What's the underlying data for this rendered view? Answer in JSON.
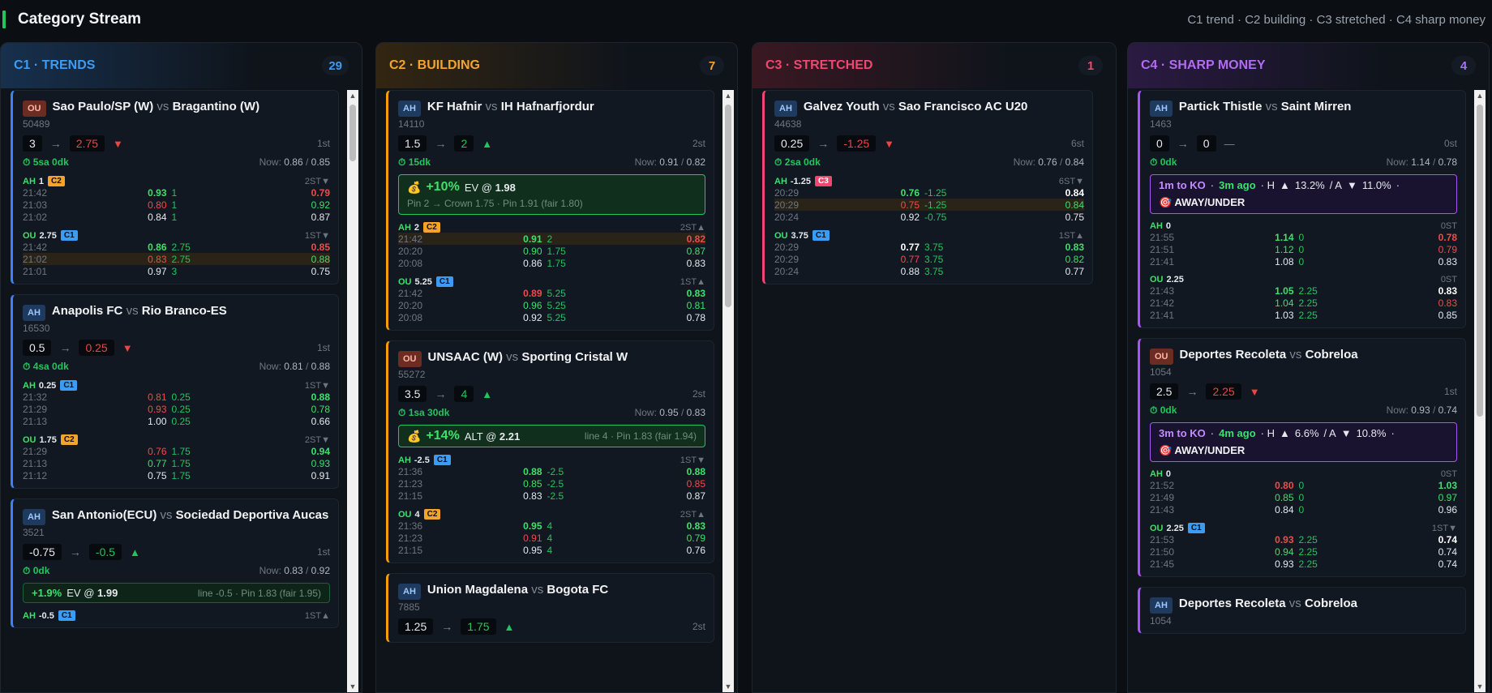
{
  "header": {
    "title": "Category Stream",
    "legend": "C1 trend · C2 building · C3 stretched · C4 sharp money"
  },
  "columns": [
    {
      "title": "C1 · TRENDS",
      "count": "29",
      "cards": [
        {
          "type": "OU",
          "home": "Sao Paulo/SP (W)",
          "away": "Bragantino (W)",
          "id": "50489",
          "from": "3",
          "to": "2.75",
          "toColor": "red",
          "dir": "dn",
          "stage": "1st",
          "time": "5sa 0dk",
          "now_a": "0.86",
          "now_b": "0.85",
          "markets": [
            {
              "kind": "AH",
              "line": "1",
              "cat": "C2",
              "stage": "2ST",
              "dir": "▼",
              "rows": [
                [
                  "21:42",
                  "0.93",
                  "1",
                  "0.79",
                  "gb",
                  "rb",
                  ""
                ],
                [
                  "21:03",
                  "0.80",
                  "1",
                  "0.92",
                  "r",
                  "g",
                  ""
                ],
                [
                  "21:02",
                  "0.84",
                  "1",
                  "0.87",
                  "w",
                  "w",
                  ""
                ]
              ]
            },
            {
              "kind": "OU",
              "line": "2.75",
              "cat": "C1",
              "stage": "1ST",
              "dir": "▼",
              "rows": [
                [
                  "21:42",
                  "0.86",
                  "2.75",
                  "0.85",
                  "gb",
                  "rb",
                  ""
                ],
                [
                  "21:02",
                  "0.83",
                  "2.75",
                  "0.88",
                  "r",
                  "g",
                  "hl"
                ],
                [
                  "21:01",
                  "0.97",
                  "3",
                  "0.75",
                  "w",
                  "w",
                  ""
                ]
              ]
            }
          ]
        },
        {
          "type": "AH",
          "home": "Anapolis FC",
          "away": "Rio Branco-ES",
          "id": "16530",
          "from": "0.5",
          "to": "0.25",
          "toColor": "red",
          "dir": "dn",
          "stage": "1st",
          "time": "4sa 0dk",
          "now_a": "0.81",
          "now_b": "0.88",
          "markets": [
            {
              "kind": "AH",
              "line": "0.25",
              "cat": "C1",
              "stage": "1ST",
              "dir": "▼",
              "rows": [
                [
                  "21:32",
                  "0.81",
                  "0.25",
                  "0.88",
                  "r",
                  "gb",
                  ""
                ],
                [
                  "21:29",
                  "0.93",
                  "0.25",
                  "0.78",
                  "r",
                  "g",
                  ""
                ],
                [
                  "21:13",
                  "1.00",
                  "0.25",
                  "0.66",
                  "w",
                  "w",
                  ""
                ]
              ]
            },
            {
              "kind": "OU",
              "line": "1.75",
              "cat": "C2",
              "stage": "2ST",
              "dir": "▼",
              "rows": [
                [
                  "21:29",
                  "0.76",
                  "1.75",
                  "0.94",
                  "r",
                  "gb",
                  ""
                ],
                [
                  "21:13",
                  "0.77",
                  "1.75",
                  "0.93",
                  "g",
                  "g",
                  ""
                ],
                [
                  "21:12",
                  "0.75",
                  "1.75",
                  "0.91",
                  "w",
                  "w",
                  ""
                ]
              ]
            }
          ]
        },
        {
          "type": "AH",
          "home": "San Antonio(ECU)",
          "away": "Sociedad Deportiva Aucas",
          "id": "3521",
          "from": "-0.75",
          "to": "-0.5",
          "toColor": "grn",
          "dir": "up",
          "stage": "1st",
          "time": "0dk",
          "now_a": "0.83",
          "now_b": "0.92",
          "ev": {
            "pct": "+1.9%",
            "label": "EV @",
            "odds": "1.99",
            "right": "line -0.5 · Pin 1.83 (fair 1.95)"
          },
          "markets": [
            {
              "kind": "AH",
              "line": "-0.5",
              "cat": "C1",
              "stage": "1ST",
              "dir": "▲",
              "rows": []
            }
          ]
        }
      ]
    },
    {
      "title": "C2 · BUILDING",
      "count": "7",
      "cards": [
        {
          "type": "AH",
          "home": "KF Hafnir",
          "away": "IH Hafnarfjordur",
          "id": "14110",
          "from": "1.5",
          "to": "2",
          "toColor": "grn",
          "dir": "up",
          "stage": "2st",
          "time": "15dk",
          "now_a": "0.91",
          "now_b": "0.82",
          "evbox": {
            "pct": "+10%",
            "label": "EV @",
            "odds": "1.98",
            "sub": "Pin 2 → Crown 1.75 · Pin 1.91 (fair 1.80)"
          },
          "markets": [
            {
              "kind": "AH",
              "line": "2",
              "cat": "C2",
              "stage": "2ST",
              "dir": "▲",
              "rows": [
                [
                  "21:42",
                  "0.91",
                  "2",
                  "0.82",
                  "gb",
                  "rb",
                  "hl"
                ],
                [
                  "20:20",
                  "0.90",
                  "1.75",
                  "0.87",
                  "g",
                  "g",
                  ""
                ],
                [
                  "20:08",
                  "0.86",
                  "1.75",
                  "0.83",
                  "w",
                  "w",
                  ""
                ]
              ]
            },
            {
              "kind": "OU",
              "line": "5.25",
              "cat": "C1",
              "stage": "1ST",
              "dir": "▲",
              "rows": [
                [
                  "21:42",
                  "0.89",
                  "5.25",
                  "0.83",
                  "rb",
                  "gb",
                  ""
                ],
                [
                  "20:20",
                  "0.96",
                  "5.25",
                  "0.81",
                  "g",
                  "g",
                  ""
                ],
                [
                  "20:08",
                  "0.92",
                  "5.25",
                  "0.78",
                  "w",
                  "w",
                  ""
                ]
              ]
            }
          ]
        },
        {
          "type": "OU",
          "home": "UNSAAC (W)",
          "away": "Sporting Cristal W",
          "id": "55272",
          "from": "3.5",
          "to": "4",
          "toColor": "grn",
          "dir": "up",
          "stage": "2st",
          "time": "1sa 30dk",
          "now_a": "0.95",
          "now_b": "0.83",
          "evinl": {
            "pct": "+14%",
            "label": "ALT @",
            "odds": "2.21",
            "right": "line 4 · Pin 1.83 (fair 1.94)"
          },
          "markets": [
            {
              "kind": "AH",
              "line": "-2.5",
              "cat": "C1",
              "stage": "1ST",
              "dir": "▼",
              "rows": [
                [
                  "21:36",
                  "0.88",
                  "-2.5",
                  "0.88",
                  "gb",
                  "gb",
                  ""
                ],
                [
                  "21:23",
                  "0.85",
                  "-2.5",
                  "0.85",
                  "g",
                  "r",
                  ""
                ],
                [
                  "21:15",
                  "0.83",
                  "-2.5",
                  "0.87",
                  "w",
                  "w",
                  ""
                ]
              ]
            },
            {
              "kind": "OU",
              "line": "4",
              "cat": "C2",
              "stage": "2ST",
              "dir": "▲",
              "rows": [
                [
                  "21:36",
                  "0.95",
                  "4",
                  "0.83",
                  "gb",
                  "gb",
                  ""
                ],
                [
                  "21:23",
                  "0.91",
                  "4",
                  "0.79",
                  "r",
                  "g",
                  ""
                ],
                [
                  "21:15",
                  "0.95",
                  "4",
                  "0.76",
                  "w",
                  "w",
                  ""
                ]
              ]
            }
          ]
        },
        {
          "type": "AH",
          "home": "Union Magdalena",
          "away": "Bogota FC",
          "id": "7885",
          "from": "1.25",
          "to": "1.75",
          "toColor": "grn",
          "dir": "up",
          "stage": "2st",
          "markets": []
        }
      ]
    },
    {
      "title": "C3 · STRETCHED",
      "count": "1",
      "cards": [
        {
          "type": "AH",
          "home": "Galvez Youth",
          "away": "Sao Francisco AC U20",
          "id": "44638",
          "from": "0.25",
          "to": "-1.25",
          "toColor": "red",
          "dir": "dn",
          "stage": "6st",
          "time": "2sa 0dk",
          "now_a": "0.76",
          "now_b": "0.84",
          "markets": [
            {
              "kind": "AH",
              "line": "-1.25",
              "cat": "C3",
              "stage": "6ST",
              "dir": "▼",
              "rows": [
                [
                  "20:29",
                  "0.76",
                  "-1.25",
                  "0.84",
                  "gb",
                  "wb",
                  ""
                ],
                [
                  "20:29",
                  "0.75",
                  "-1.25",
                  "0.84",
                  "r",
                  "g",
                  "hl"
                ],
                [
                  "20:24",
                  "0.92",
                  "-0.75",
                  "0.75",
                  "w",
                  "w",
                  ""
                ]
              ]
            },
            {
              "kind": "OU",
              "line": "3.75",
              "cat": "C1",
              "stage": "1ST",
              "dir": "▲",
              "rows": [
                [
                  "20:29",
                  "0.77",
                  "3.75",
                  "0.83",
                  "wb",
                  "gb",
                  ""
                ],
                [
                  "20:29",
                  "0.77",
                  "3.75",
                  "0.82",
                  "r",
                  "g",
                  ""
                ],
                [
                  "20:24",
                  "0.88",
                  "3.75",
                  "0.77",
                  "w",
                  "w",
                  ""
                ]
              ]
            }
          ]
        }
      ]
    },
    {
      "title": "C4 · SHARP MONEY",
      "count": "4",
      "cards": [
        {
          "type": "AH",
          "home": "Partick Thistle",
          "away": "Saint Mirren",
          "id": "1463",
          "from": "0",
          "to": "0",
          "toColor": "",
          "dir": "fl",
          "stage": "0st",
          "time": "0dk",
          "now_a": "1.14",
          "now_b": "0.78",
          "sharp": {
            "ko": "1m to KO",
            "ago": "3m ago",
            "h": "13.2%",
            "a": "11.0%",
            "pick": "AWAY/UNDER"
          },
          "markets": [
            {
              "kind": "AH",
              "line": "0",
              "cat": "",
              "stage": "0ST",
              "dir": "",
              "rows": [
                [
                  "21:55",
                  "1.14",
                  "0",
                  "0.78",
                  "gb",
                  "rb",
                  ""
                ],
                [
                  "21:51",
                  "1.12",
                  "0",
                  "0.79",
                  "g",
                  "r",
                  ""
                ],
                [
                  "21:41",
                  "1.08",
                  "0",
                  "0.83",
                  "w",
                  "w",
                  ""
                ]
              ]
            },
            {
              "kind": "OU",
              "line": "2.25",
              "cat": "",
              "stage": "0ST",
              "dir": "",
              "rows": [
                [
                  "21:43",
                  "1.05",
                  "2.25",
                  "0.83",
                  "gb",
                  "wb",
                  ""
                ],
                [
                  "21:42",
                  "1.04",
                  "2.25",
                  "0.83",
                  "g",
                  "r",
                  ""
                ],
                [
                  "21:41",
                  "1.03",
                  "2.25",
                  "0.85",
                  "w",
                  "w",
                  ""
                ]
              ]
            }
          ]
        },
        {
          "type": "OU",
          "home": "Deportes Recoleta",
          "away": "Cobreloa",
          "id": "1054",
          "from": "2.5",
          "to": "2.25",
          "toColor": "red",
          "dir": "dn",
          "stage": "1st",
          "time": "0dk",
          "now_a": "0.93",
          "now_b": "0.74",
          "sharp": {
            "ko": "3m to KO",
            "ago": "4m ago",
            "h": "6.6%",
            "a": "10.8%",
            "pick": "AWAY/UNDER"
          },
          "markets": [
            {
              "kind": "AH",
              "line": "0",
              "cat": "",
              "stage": "0ST",
              "dir": "",
              "rows": [
                [
                  "21:52",
                  "0.80",
                  "0",
                  "1.03",
                  "rb",
                  "gb",
                  ""
                ],
                [
                  "21:49",
                  "0.85",
                  "0",
                  "0.97",
                  "g",
                  "g",
                  ""
                ],
                [
                  "21:43",
                  "0.84",
                  "0",
                  "0.96",
                  "w",
                  "w",
                  ""
                ]
              ]
            },
            {
              "kind": "OU",
              "line": "2.25",
              "cat": "C1",
              "stage": "1ST",
              "dir": "▼",
              "rows": [
                [
                  "21:53",
                  "0.93",
                  "2.25",
                  "0.74",
                  "rb",
                  "wb",
                  ""
                ],
                [
                  "21:50",
                  "0.94",
                  "2.25",
                  "0.74",
                  "g",
                  "w",
                  ""
                ],
                [
                  "21:45",
                  "0.93",
                  "2.25",
                  "0.74",
                  "w",
                  "w",
                  ""
                ]
              ]
            }
          ]
        },
        {
          "type": "AH",
          "home": "Deportes Recoleta",
          "away": "Cobreloa",
          "id": "1054",
          "markets": []
        }
      ]
    }
  ],
  "icons": {
    "timer": "stopwatch-icon",
    "bag": "money-bag-icon",
    "target": "target-icon"
  }
}
